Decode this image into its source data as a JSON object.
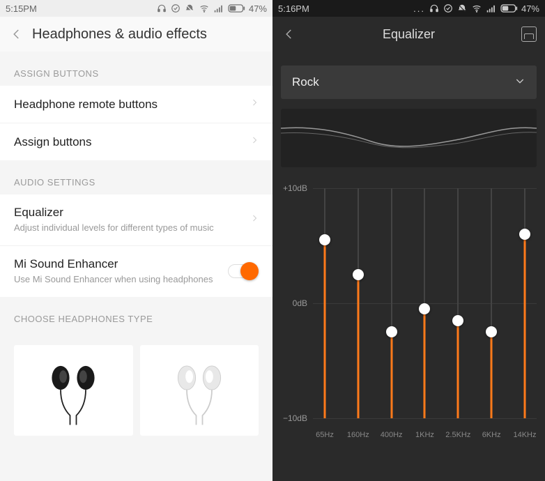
{
  "left": {
    "status": {
      "time": "5:15PM",
      "battery": "47%"
    },
    "header": {
      "title": "Headphones & audio effects"
    },
    "sections": {
      "assign_label": "ASSIGN BUTTONS",
      "assign_items": [
        "Headphone remote buttons",
        "Assign buttons"
      ],
      "audio_label": "AUDIO SETTINGS",
      "equalizer_title": "Equalizer",
      "equalizer_sub": "Adjust individual levels for different types of music",
      "enhancer_title": "Mi Sound Enhancer",
      "enhancer_sub": "Use Mi Sound Enhancer when using headphones",
      "choose_label": "CHOOSE HEADPHONES TYPE"
    }
  },
  "right": {
    "status": {
      "time": "5:16PM",
      "battery": "47%"
    },
    "header": {
      "title": "Equalizer"
    },
    "preset": "Rock",
    "y_labels": {
      "top": "+10dB",
      "mid": "0dB",
      "bot": "−10dB"
    },
    "bands": [
      {
        "freq": "65Hz",
        "db": 5.5
      },
      {
        "freq": "160Hz",
        "db": 2.5
      },
      {
        "freq": "400Hz",
        "db": -2.5
      },
      {
        "freq": "1KHz",
        "db": -0.5
      },
      {
        "freq": "2.5KHz",
        "db": -1.5
      },
      {
        "freq": "6KHz",
        "db": -2.5
      },
      {
        "freq": "14KHz",
        "db": 6
      }
    ]
  }
}
